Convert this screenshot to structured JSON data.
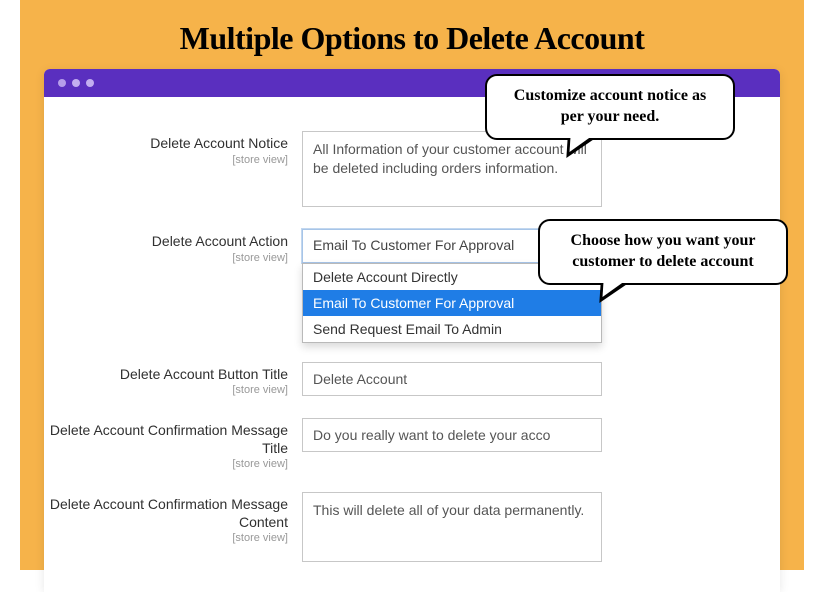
{
  "page_title": "Multiple Options to Delete Account",
  "bubbles": {
    "notice": "Customize account notice as per your need.",
    "action": "Choose how you want your customer to delete account"
  },
  "form": {
    "notice": {
      "label": "Delete Account Notice",
      "scope": "[store view]",
      "value": "All Information of your customer account will be deleted including orders information."
    },
    "action": {
      "label": "Delete Account Action",
      "scope": "[store view]",
      "selected": "Email To Customer For Approval",
      "options": [
        "Delete Account Directly",
        "Email To Customer For Approval",
        "Send Request Email To Admin"
      ]
    },
    "button_title": {
      "label": "Delete Account Button Title",
      "scope": "[store view]",
      "value": "Delete Account"
    },
    "confirm_title": {
      "label": "Delete Account Confirmation Message Title",
      "scope": "[store view]",
      "value": "Do you really want to delete your acco"
    },
    "confirm_content": {
      "label": "Delete Account Confirmation Message Content",
      "scope": "[store view]",
      "value": "This will delete all of your data permanently."
    }
  }
}
